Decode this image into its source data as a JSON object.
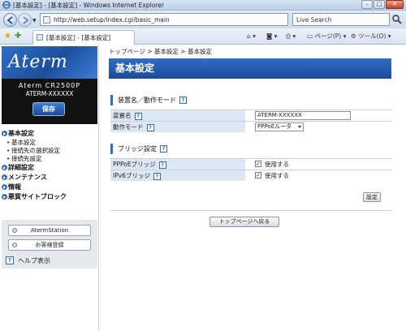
{
  "window": {
    "title": "[基本設定] - [基本設定] - Windows Internet Explorer",
    "controls": {
      "minimize": "–",
      "maximize": "□",
      "close": "✕"
    }
  },
  "address_bar": {
    "url": "http://web.setup/index.cgi/basic_main",
    "search_placeholder": "Live Search"
  },
  "toolbar": {
    "tab_label": "[基本設定] - [基本設定]",
    "page_menu": "ページ(P)",
    "tools_menu": "ツール(O)"
  },
  "sidebar": {
    "logo": "Aterm",
    "model": "Aterm CR2500P",
    "device_name": "ATERM-XXXXXX",
    "save_label": "保存",
    "menu": [
      {
        "label": "基本設定",
        "subitems": [
          "基本設定",
          "接続先の選択設定",
          "接続先設定"
        ]
      },
      {
        "label": "詳細設定",
        "subitems": []
      },
      {
        "label": "メンテナンス",
        "subitems": []
      },
      {
        "label": "情報",
        "subitems": []
      },
      {
        "label": "悪質サイトブロック",
        "subitems": []
      }
    ],
    "aterm_station": "AtermStation",
    "customer_reg": "お客様登録",
    "help": "ヘルプ表示"
  },
  "main": {
    "breadcrumb": "トップページ > 基本設定 > 基本設定",
    "title": "基本設定",
    "section1": {
      "heading": "装置名／動作モード",
      "device_label": "装置名",
      "device_value": "ATERM-XXXXXX",
      "mode_label": "動作モード",
      "mode_value": "PPPoEルータ"
    },
    "section2": {
      "heading": "ブリッジ設定",
      "pppoe_label": "PPPoEブリッジ",
      "pppoe_check": "使用する",
      "ipv6_label": "IPv6ブリッジ",
      "ipv6_check": "使用する"
    },
    "set_button": "設定",
    "top_button": "トップページへ戻る"
  },
  "colors": {
    "accent": "#2f6dc3",
    "accent_dark": "#1a4a9a",
    "label_bg": "#dde7f3"
  }
}
